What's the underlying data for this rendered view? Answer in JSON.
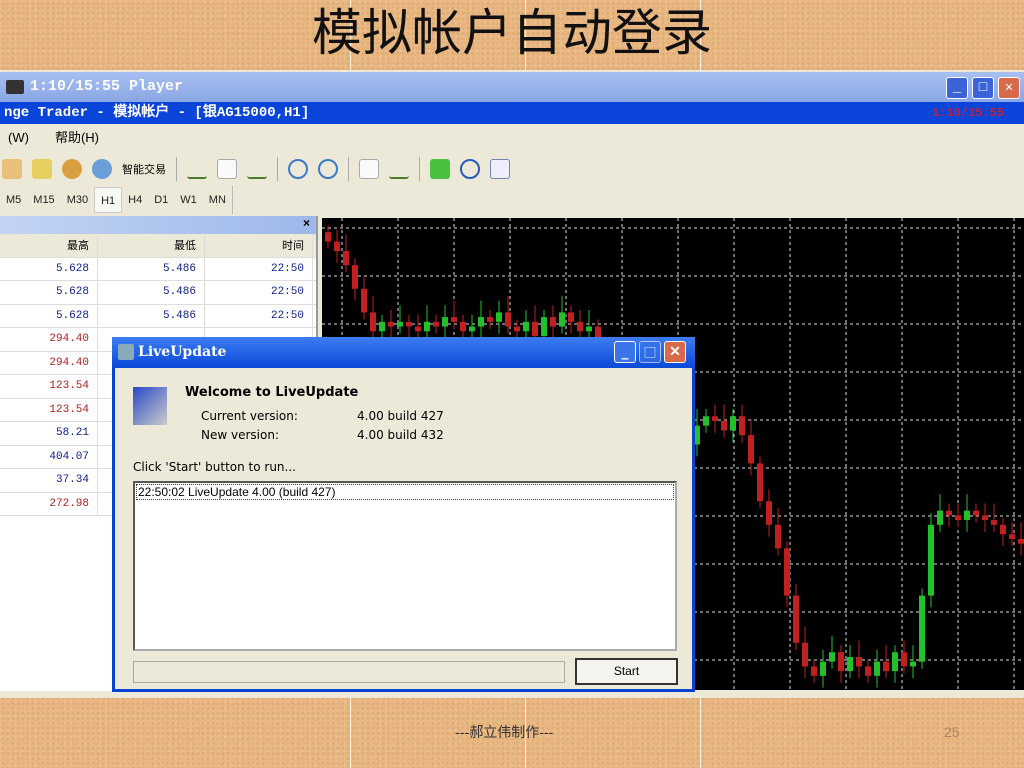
{
  "slide": {
    "title": "模拟帐户自动登录",
    "footer": "---郝立伟制作---",
    "page": "25"
  },
  "player": {
    "title": "1:10/15:55 Player"
  },
  "app": {
    "title": "nge Trader - 模拟帐户 - [银AG15000,H1]",
    "clock": "1:10/15:55",
    "menu": [
      "(W)",
      "帮助(H)"
    ],
    "toolbar_label": "智能交易",
    "timeframes": [
      "M5",
      "M15",
      "M30",
      "H1",
      "H4",
      "D1",
      "W1",
      "MN"
    ],
    "active_timeframe": "H1"
  },
  "market": {
    "columns": [
      "最高",
      "最低",
      "时间"
    ],
    "close_label": "×",
    "rows": [
      {
        "high": "5.628",
        "low": "5.486",
        "time": "22:50",
        "color": "blue"
      },
      {
        "high": "5.628",
        "low": "5.486",
        "time": "22:50",
        "color": "blue"
      },
      {
        "high": "5.628",
        "low": "5.486",
        "time": "22:50",
        "color": "blue"
      },
      {
        "high": "294.40",
        "low": "",
        "time": "",
        "color": "red"
      },
      {
        "high": "294.40",
        "low": "",
        "time": "",
        "color": "red"
      },
      {
        "high": "123.54",
        "low": "",
        "time": "",
        "color": "red"
      },
      {
        "high": "123.54",
        "low": "",
        "time": "",
        "color": "red"
      },
      {
        "high": "58.21",
        "low": "",
        "time": "",
        "color": "blue"
      },
      {
        "high": "404.07",
        "low": "",
        "time": "",
        "color": "blue"
      },
      {
        "high": "37.34",
        "low": "",
        "time": "",
        "color": "blue"
      },
      {
        "high": "272.98",
        "low": "",
        "time": "",
        "color": "red"
      }
    ]
  },
  "dialog": {
    "title": "LiveUpdate",
    "heading": "Welcome to LiveUpdate",
    "current_label": "Current version:",
    "current_value": "4.00 build 427",
    "new_label": "New version:",
    "new_value": "4.00 build 432",
    "instruction": "Click 'Start'  button to run...",
    "log": [
      "22:50:02 LiveUpdate 4.00 (build 427)"
    ],
    "start_label": "Start"
  },
  "chart_data": {
    "type": "candlestick",
    "closes": [
      95,
      93,
      90,
      85,
      80,
      76,
      78,
      77,
      78,
      77,
      76,
      78,
      77,
      79,
      78,
      76,
      77,
      79,
      78,
      80,
      77,
      76,
      78,
      75,
      79,
      77,
      80,
      78,
      76,
      77,
      70,
      65,
      60,
      58,
      62,
      60,
      57,
      55,
      56,
      58,
      52,
      56,
      58,
      57,
      55,
      58,
      54,
      48,
      40,
      35,
      30,
      20,
      10,
      5,
      3,
      6,
      8,
      4,
      7,
      5,
      3,
      6,
      4,
      8,
      5,
      6,
      20,
      35,
      38,
      37,
      36,
      38,
      37,
      36,
      35,
      33,
      32,
      31
    ],
    "up_color": "#22c02a",
    "down_color": "#c02020"
  }
}
